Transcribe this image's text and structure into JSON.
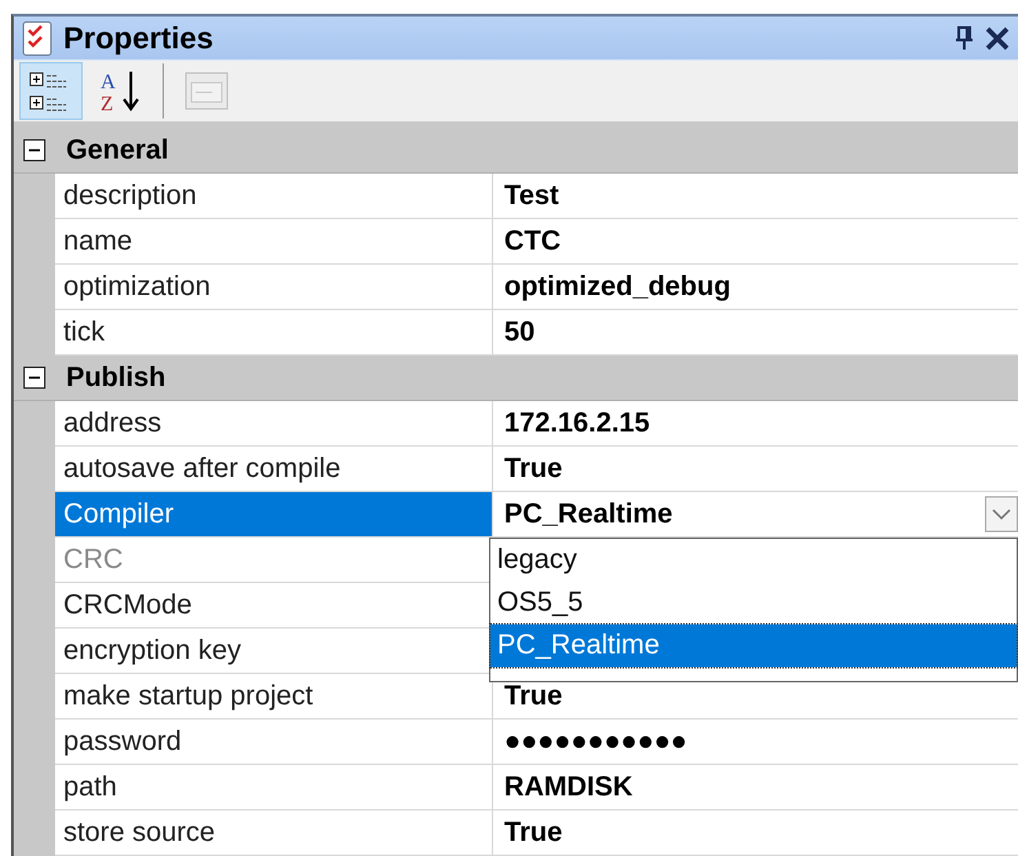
{
  "window": {
    "title": "Properties"
  },
  "toolbar": [
    {
      "kind": "categorized",
      "selected": true,
      "disabled": false
    },
    {
      "kind": "alphabetical",
      "selected": false,
      "disabled": false,
      "letters": [
        "A",
        "Z"
      ]
    },
    {
      "kind": "separator"
    },
    {
      "kind": "pages",
      "selected": false,
      "disabled": true
    }
  ],
  "categories": [
    {
      "name": "General",
      "expanded": true,
      "properties": [
        {
          "name": "description",
          "value": "Test",
          "selected": false,
          "disabled": false
        },
        {
          "name": "name",
          "value": "CTC",
          "selected": false,
          "disabled": false
        },
        {
          "name": "optimization",
          "value": "optimized_debug",
          "selected": false,
          "disabled": false
        },
        {
          "name": "tick",
          "value": "50",
          "selected": false,
          "disabled": false
        }
      ]
    },
    {
      "name": "Publish",
      "expanded": true,
      "properties": [
        {
          "name": "address",
          "value": "172.16.2.15",
          "selected": false,
          "disabled": false
        },
        {
          "name": "autosave after compile",
          "value": "True",
          "selected": false,
          "disabled": false
        },
        {
          "name": "Compiler",
          "value": "PC_Realtime",
          "selected": true,
          "disabled": false,
          "dropdown": {
            "open": true,
            "options": [
              {
                "label": "legacy",
                "selected": false
              },
              {
                "label": "OS5_5",
                "selected": false
              },
              {
                "label": "PC_Realtime",
                "selected": true
              }
            ]
          }
        },
        {
          "name": "CRC",
          "selected": false,
          "disabled": true
        },
        {
          "name": "CRCMode",
          "selected": false,
          "disabled": false
        },
        {
          "name": "encryption key",
          "selected": false,
          "disabled": false
        },
        {
          "name": "make startup project",
          "value": "True",
          "selected": false,
          "disabled": false
        },
        {
          "name": "password",
          "value": "●●●●●●●●●●●",
          "selected": false,
          "disabled": false
        },
        {
          "name": "path",
          "value": "RAMDISK",
          "selected": false,
          "disabled": false
        },
        {
          "name": "store source",
          "value": "True",
          "selected": false,
          "disabled": false
        }
      ]
    }
  ]
}
